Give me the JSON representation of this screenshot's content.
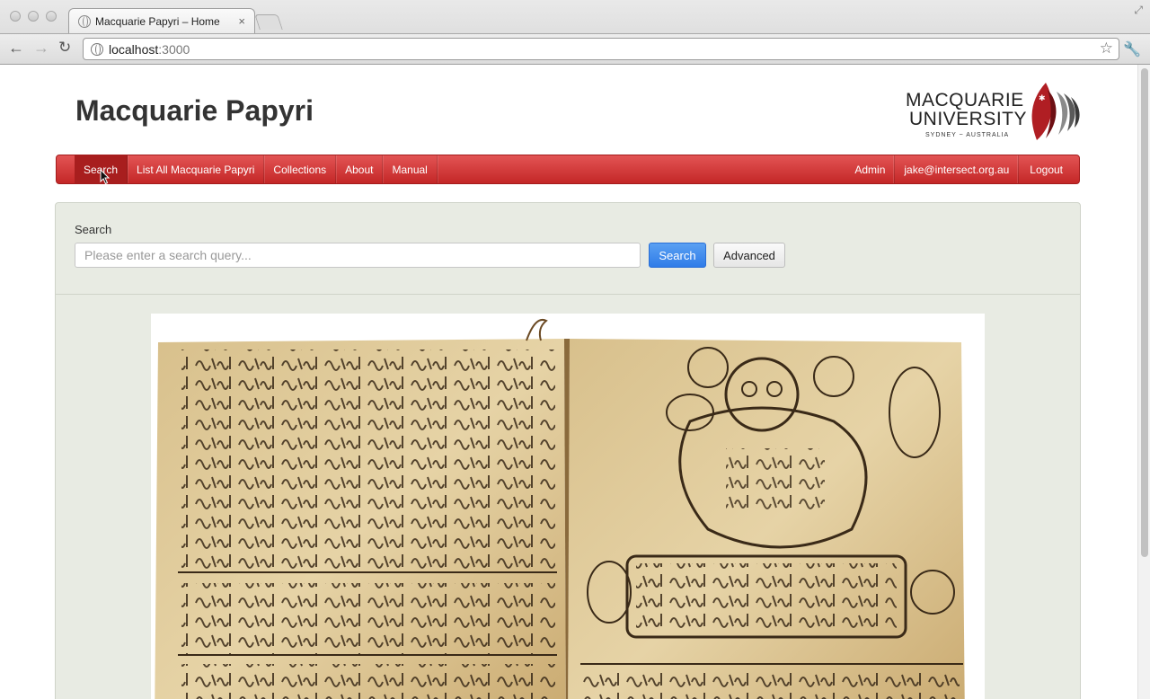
{
  "browser": {
    "tab_title": "Macquarie Papyri – Home",
    "tab_close": "×",
    "url_host": "localhost",
    "url_port": ":3000",
    "back_icon": "arrow-left-icon",
    "forward_icon": "arrow-right-icon",
    "reload_icon": "reload-icon",
    "bookmark_icon": "star-icon",
    "menu_icon": "wrench-icon"
  },
  "header": {
    "site_title": "Macquarie Papyri",
    "logo_line1": "MACQUARIE",
    "logo_line2": "UNIVERSITY",
    "logo_line3": "SYDNEY ~ AUSTRALIA"
  },
  "nav": {
    "left": [
      {
        "label": "Search",
        "active": true
      },
      {
        "label": "List All Macquarie Papyri"
      },
      {
        "label": "Collections"
      },
      {
        "label": "About"
      },
      {
        "label": "Manual"
      }
    ],
    "right": [
      {
        "label": "Admin"
      },
      {
        "label": "jake@intersect.org.au"
      },
      {
        "label": "Logout"
      }
    ]
  },
  "search": {
    "label": "Search",
    "placeholder": "Please enter a search query...",
    "value": "",
    "search_button": "Search",
    "advanced_button": "Advanced"
  },
  "colors": {
    "navbar": "#d23a3a",
    "nav_active": "#a81e1e",
    "panel": "#e8ebe3",
    "primary_button": "#3a85ec",
    "logo_red": "#b01e23"
  }
}
